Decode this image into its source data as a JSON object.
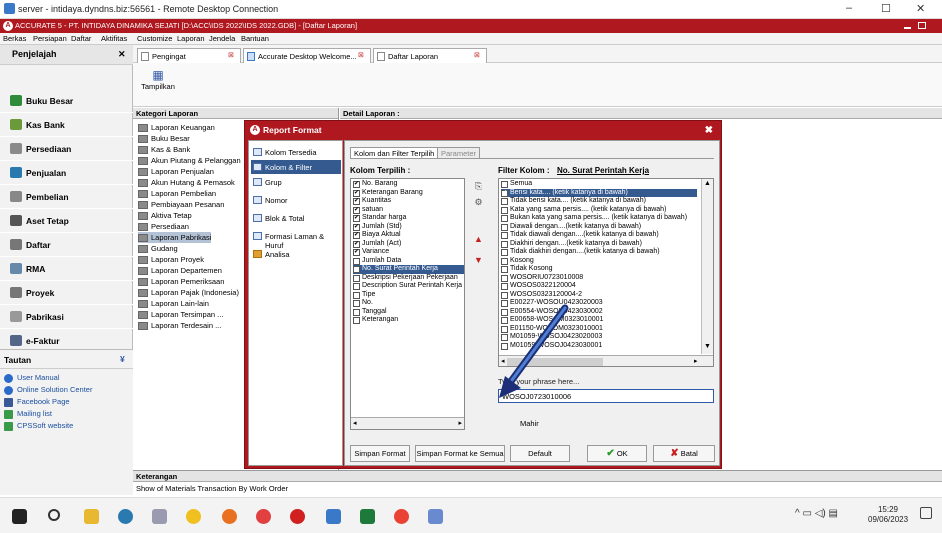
{
  "rdp": {
    "title": "server - intidaya.dyndns.biz:56561 - Remote Desktop Connection",
    "minimize": "–",
    "maximize": "☐",
    "close": "✕"
  },
  "app": {
    "title": "ACCURATE 5 - PT. INTIDAYA DINAMIKA SEJATI  [D:\\ACC\\IDS 2022\\IDS 2022.GDB] - [Daftar Laporan]"
  },
  "menu": [
    "Berkas",
    "Persiapan",
    "Daftar",
    "Aktifitas",
    "Customize",
    "Laporan",
    "Jendela",
    "Bantuan"
  ],
  "sidebar": {
    "header": "Penjelajah",
    "close": "✕",
    "items": [
      {
        "label": "Buku Besar",
        "color": "#2e8b3a"
      },
      {
        "label": "Kas Bank",
        "color": "#6a9a3a"
      },
      {
        "label": "Persediaan",
        "color": "#8a8a8a"
      },
      {
        "label": "Penjualan",
        "color": "#2a7ab0"
      },
      {
        "label": "Pembelian",
        "color": "#888888"
      },
      {
        "label": "Aset Tetap",
        "color": "#555555"
      },
      {
        "label": "Daftar",
        "color": "#777777"
      },
      {
        "label": "RMA",
        "color": "#6688aa"
      },
      {
        "label": "Proyek",
        "color": "#777777"
      },
      {
        "label": "Pabrikasi",
        "color": "#999999"
      },
      {
        "label": "e-Faktur",
        "color": "#556688"
      }
    ]
  },
  "tautan": {
    "header": "Tautan",
    "collapse": "¥",
    "links": [
      {
        "label": "User Manual",
        "color": "#2a6ac8"
      },
      {
        "label": "Online Solution Center",
        "color": "#2a6ac8"
      },
      {
        "label": "Facebook Page",
        "color": "#3b5998"
      },
      {
        "label": "Mailing list",
        "color": "#3a9a4a"
      },
      {
        "label": "CPSSoft website",
        "color": "#3a9a4a"
      }
    ]
  },
  "tabs": [
    {
      "label": "Pengingat"
    },
    {
      "label": "Accurate Desktop Welcome..."
    },
    {
      "label": "Daftar Laporan"
    }
  ],
  "toolbar": {
    "tampilkan": "Tampilkan",
    "grid_icon": "▦"
  },
  "kategori": {
    "header": "Kategori Laporan",
    "items": [
      "Laporan Keuangan",
      "Buku Besar",
      "Kas & Bank",
      "Akun Piutang & Pelanggan",
      "Laporan Penjualan",
      "Akun Hutang & Pemasok",
      "Laporan Pembelian",
      "Pembiayaan Pesanan",
      "Aktiva Tetap",
      "Persediaan",
      "Laporan Pabrikasi",
      "Gudang",
      "Laporan Proyek",
      "Laporan Departemen",
      "Laporan Pemeriksaan",
      "Laporan Pajak (Indonesia)",
      "Laporan Lain-lain",
      "Laporan Tersimpan ...",
      "Laporan Terdesain ..."
    ],
    "selected_index": 10
  },
  "detail": {
    "header": "Detail Laporan :"
  },
  "keterangan": {
    "header": "Keterangan",
    "text": "Show of Materials Transaction By Work Order"
  },
  "dialog": {
    "title": "Report Format",
    "close": "✖",
    "left_items": [
      "Kolom Tersedia",
      "Kolom & Filter",
      "Grup",
      "Nomor",
      "Blok & Total",
      "Formasi Laman & Huruf",
      "Analisa"
    ],
    "left_selected": 1,
    "tabs": [
      "Kolom dan Filter Terpilih",
      "Parameter"
    ],
    "kolom_label": "Kolom Terpilih :",
    "kolom_items": [
      {
        "label": "No. Barang",
        "checked": true
      },
      {
        "label": "Keterangan Barang",
        "checked": true
      },
      {
        "label": "Kuantitas",
        "checked": true
      },
      {
        "label": "satuan",
        "checked": true
      },
      {
        "label": "Standar harga",
        "checked": true
      },
      {
        "label": "Jumlah (Std)",
        "checked": true
      },
      {
        "label": "Biaya Aktual",
        "checked": true
      },
      {
        "label": "Jumlah (Act)",
        "checked": true
      },
      {
        "label": "Variance",
        "checked": true
      },
      {
        "label": "Jumlah Data",
        "checked": false
      },
      {
        "label": "No. Surat Perintah Kerja",
        "checked": false,
        "selected": true
      },
      {
        "label": "Deskripsi Pekerjaan Pekerjaan",
        "checked": false
      },
      {
        "label": "Description Surat Perintah Kerja",
        "checked": false
      },
      {
        "label": "Tipe",
        "checked": false
      },
      {
        "label": "No.",
        "checked": false
      },
      {
        "label": "Tanggal",
        "checked": false
      },
      {
        "label": "Keterangan",
        "checked": false
      }
    ],
    "filter_label": "Filter Kolom :",
    "filter_column": "No. Surat Perintah Kerja",
    "filter_items": [
      {
        "label": "Semua",
        "checked": false
      },
      {
        "label": "Berisi kata.... (ketik katanya di bawah)",
        "checked": true,
        "selected": true
      },
      {
        "label": "Tidak berisi kata.... (ketik katanya di bawah)",
        "checked": false
      },
      {
        "label": "Kata yang sama persis.... (ketik katanya di bawah)",
        "checked": false
      },
      {
        "label": "Bukan kata yang sama persis.... (ketik katanya di bawah)",
        "checked": false
      },
      {
        "label": "Diawali dengan....(ketik katanya di bawah)",
        "checked": false
      },
      {
        "label": "Tidak diawali dengan....(ketik katanya di bawah)",
        "checked": false
      },
      {
        "label": "Diakhiri dengan....(ketik katanya di bawah)",
        "checked": false
      },
      {
        "label": "Tidak diakhiri dengan....(ketik katanya di bawah)",
        "checked": false
      },
      {
        "label": "Kosong",
        "checked": false
      },
      {
        "label": "Tidak Kosong",
        "checked": false
      },
      {
        "label": "WOSORIU0723010008",
        "checked": false
      },
      {
        "label": "WOSOS0322120004",
        "checked": false
      },
      {
        "label": "WOSOS0323120004-2",
        "checked": false
      },
      {
        "label": "E00227-WOSOU0423020003",
        "checked": false
      },
      {
        "label": "E00554-WOSOU0423030002",
        "checked": false
      },
      {
        "label": "E00658-WOSOM0323010001",
        "checked": false
      },
      {
        "label": "E01150-WOSOM0323010001",
        "checked": false
      },
      {
        "label": "M01059-WOSOJ0423020003",
        "checked": false
      },
      {
        "label": "M01059-WOSOJ0423030001",
        "checked": false
      }
    ],
    "type_phrase_label": "Type your phrase here...",
    "search_value": "WOSOJ0723010006",
    "mahir": "Mahir",
    "buttons": {
      "simpan": "Simpan Format",
      "simpan_semua": "Simpan Format ke Semua",
      "default": "Default",
      "ok": "OK",
      "batal": "Batal"
    }
  },
  "taskbar": {
    "time": "15:29",
    "date": "09/06/2023"
  }
}
